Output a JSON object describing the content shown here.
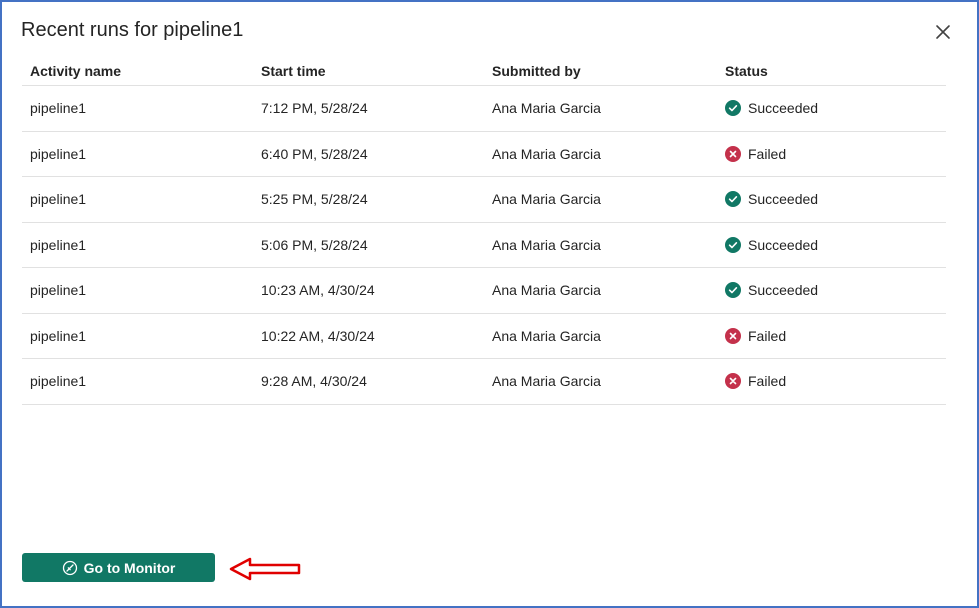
{
  "dialog": {
    "title": "Recent runs for pipeline1"
  },
  "table": {
    "headers": [
      "Activity name",
      "Start time",
      "Submitted by",
      "Status"
    ],
    "rows": [
      {
        "activity": "pipeline1",
        "start": "7:12 PM, 5/28/24",
        "submitted_by": "Ana Maria Garcia",
        "status": "Succeeded"
      },
      {
        "activity": "pipeline1",
        "start": "6:40 PM, 5/28/24",
        "submitted_by": "Ana Maria Garcia",
        "status": "Failed"
      },
      {
        "activity": "pipeline1",
        "start": "5:25 PM, 5/28/24",
        "submitted_by": "Ana Maria Garcia",
        "status": "Succeeded"
      },
      {
        "activity": "pipeline1",
        "start": "5:06 PM, 5/28/24",
        "submitted_by": "Ana Maria Garcia",
        "status": "Succeeded"
      },
      {
        "activity": "pipeline1",
        "start": "10:23 AM, 4/30/24",
        "submitted_by": "Ana Maria Garcia",
        "status": "Succeeded"
      },
      {
        "activity": "pipeline1",
        "start": "10:22 AM, 4/30/24",
        "submitted_by": "Ana Maria Garcia",
        "status": "Failed"
      },
      {
        "activity": "pipeline1",
        "start": "9:28 AM, 4/30/24",
        "submitted_by": "Ana Maria Garcia",
        "status": "Failed"
      }
    ]
  },
  "footer": {
    "monitor_button_label": "Go to Monitor"
  },
  "icons": {
    "close": "close-icon",
    "succeeded": "check-circle-icon",
    "failed": "error-circle-icon",
    "monitor": "monitor-icon",
    "annotation": "red-arrow-icon"
  },
  "colors": {
    "succeeded": "#117865",
    "failed": "#c4314b",
    "primary_button": "#117865",
    "dialog_border": "#4472c4",
    "annotation_arrow": "#e00000"
  }
}
